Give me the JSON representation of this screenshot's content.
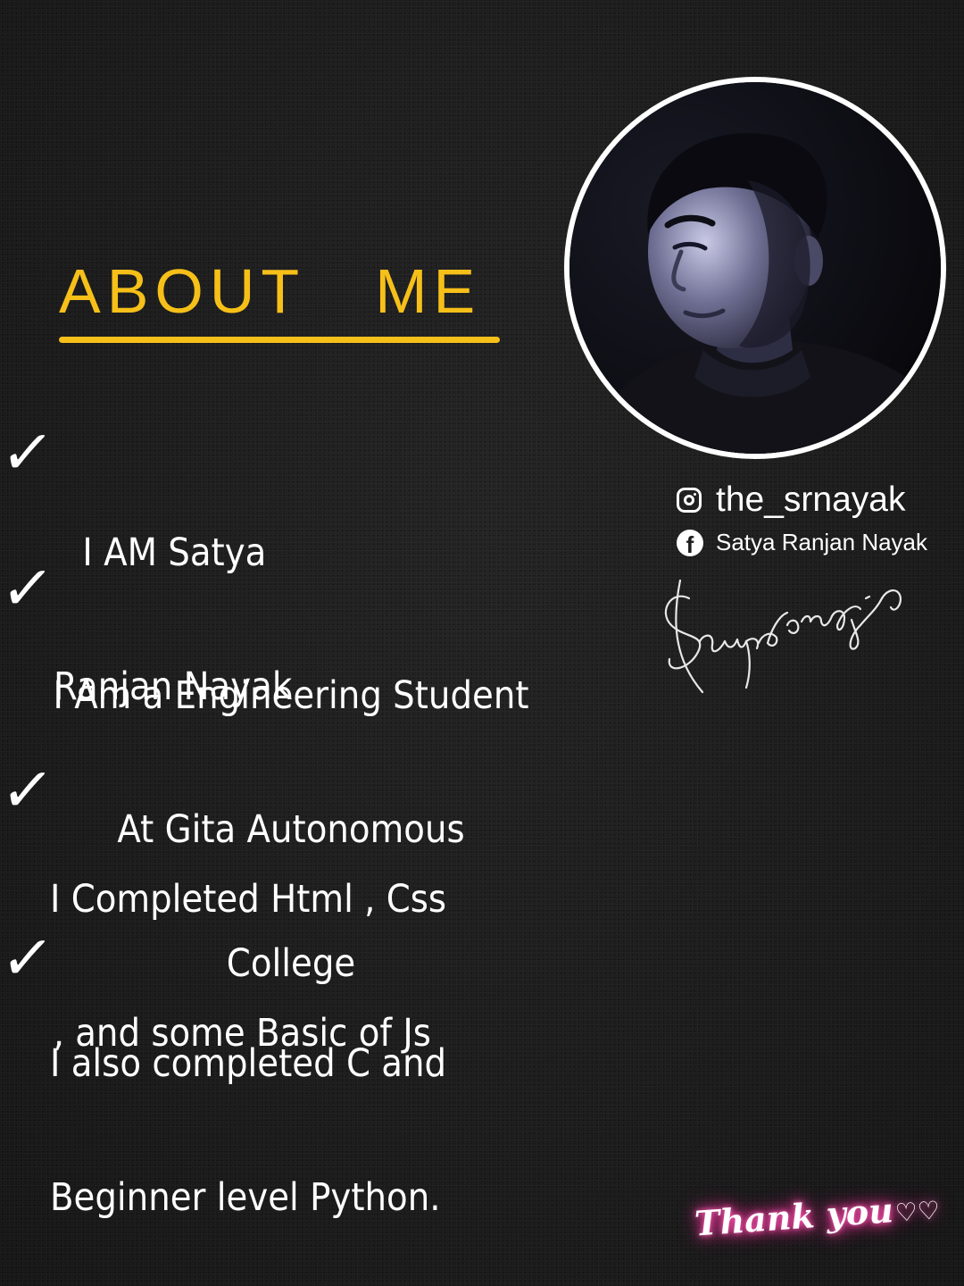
{
  "header": {
    "title": "ABOUT   ME"
  },
  "bullets": [
    {
      "lines": [
        "I AM Satya",
        "Ranjan Nayak"
      ]
    },
    {
      "lines": [
        "I Am a Engineering Student",
        "At Gita Autonomous",
        "College"
      ]
    },
    {
      "lines": [
        "I Completed Html , Css",
        ", and some Basic of Js"
      ]
    },
    {
      "lines": [
        "I also completed C and",
        "Beginner level Python."
      ]
    }
  ],
  "profile": {
    "instagram_handle": "the_srnayak",
    "facebook_name": "Satya Ranjan Nayak",
    "signature_text": "Satyaranjan"
  },
  "footer": {
    "thanks": "Thank you"
  },
  "check_glyph": "✓",
  "icons": {
    "check": "check-mark-icon",
    "instagram": "instagram-icon",
    "facebook": "facebook-icon",
    "heart": "heart-icon"
  },
  "colors": {
    "background": "#181818",
    "accent": "#f6c019",
    "text": "#ffffff",
    "glow": "#ff3fa6"
  }
}
